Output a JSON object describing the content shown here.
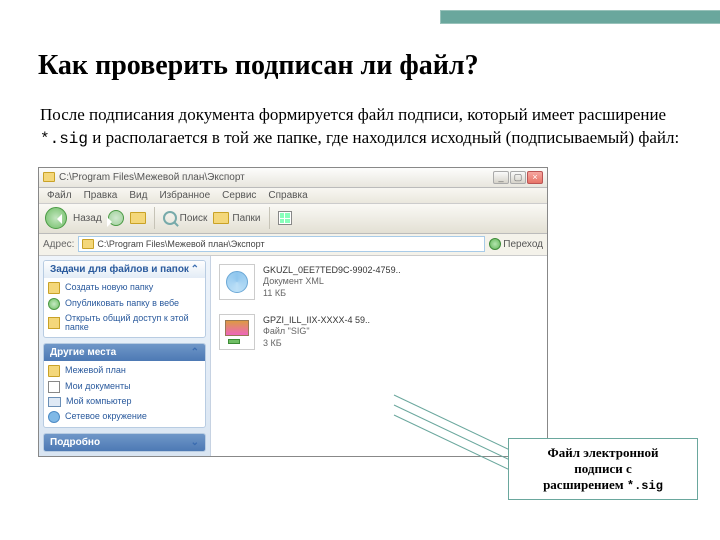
{
  "slide": {
    "title": "Как проверить подписан ли файл?",
    "body_prefix": "После подписания документа формируется файл подписи, который имеет расширение ",
    "extension": "*.sig",
    "body_suffix": " и располагается в той же папке, где находился исходный (подписываемый) файл:"
  },
  "explorer": {
    "title_path": "C:\\Program Files\\Межевой план\\Экспорт",
    "menu": [
      "Файл",
      "Правка",
      "Вид",
      "Избранное",
      "Сервис",
      "Справка"
    ],
    "toolbar": {
      "back": "Назад",
      "search": "Поиск",
      "folders": "Папки"
    },
    "address": {
      "label": "Адрес:",
      "value": "C:\\Program Files\\Межевой план\\Экспорт",
      "go": "Переход"
    },
    "task_panel": {
      "title": "Задачи для файлов и папок",
      "items": [
        "Создать новую папку",
        "Опубликовать папку в вебе",
        "Открыть общий доступ к этой папке"
      ]
    },
    "places_panel": {
      "title": "Другие места",
      "items": [
        "Межевой план",
        "Мои документы",
        "Мой компьютер",
        "Сетевое окружение"
      ]
    },
    "details_panel": {
      "title": "Подробно"
    },
    "files": {
      "xml": {
        "name": "GKUZL_0EE7TED9C-9902-4759..",
        "type": "Документ XML",
        "size": "11 КБ"
      },
      "sig": {
        "name": "GPZI_ILL_IIX-XXXX-4 59..",
        "type": "Файл \"SIG\"",
        "size": "3 КБ"
      }
    }
  },
  "callout": {
    "line1": "Файл электронной",
    "line2": "подписи с",
    "line3_prefix": "расширением ",
    "ext": "*.sig"
  }
}
